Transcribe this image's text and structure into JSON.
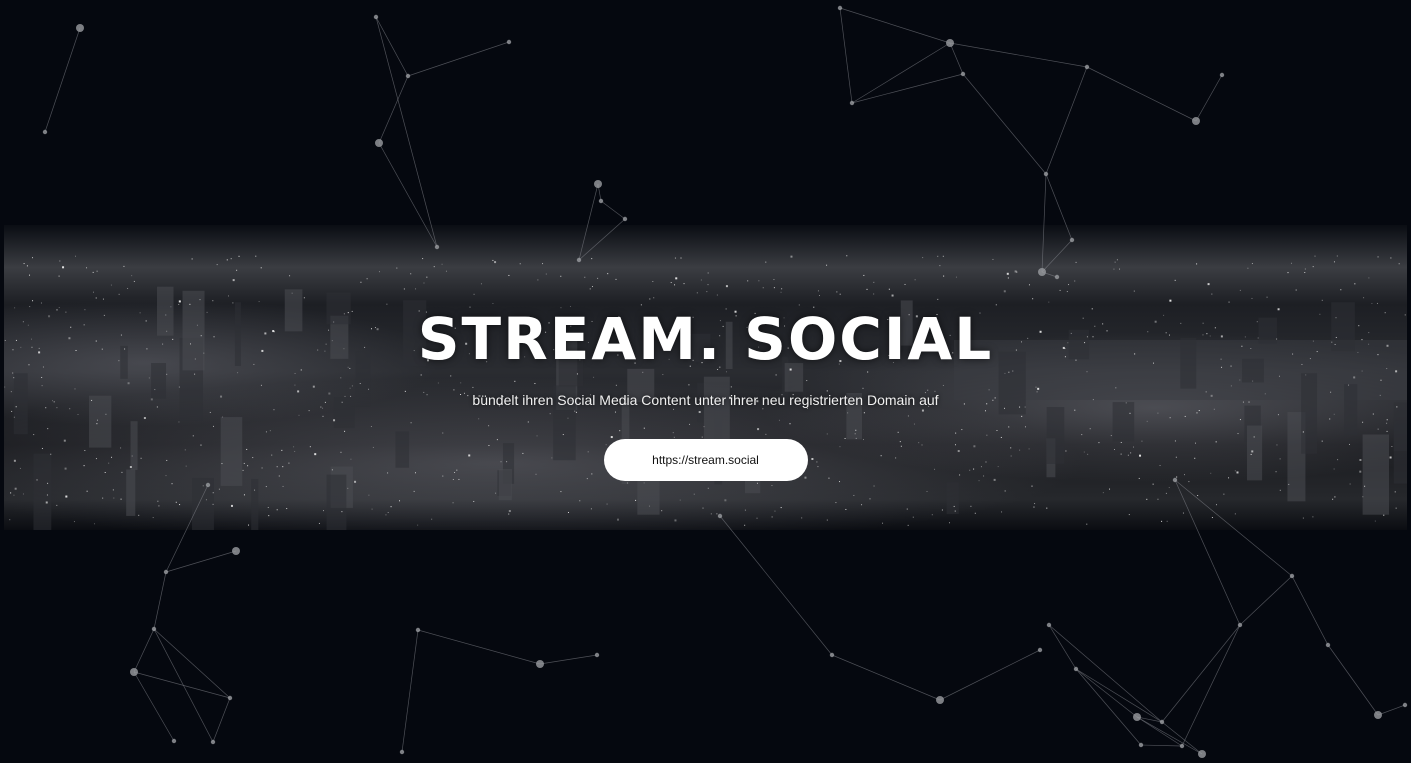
{
  "hero": {
    "title": "STREAM. SOCIAL",
    "subtitle": "bündelt ihren Social Media Content unter ihrer neu registrierten Domain auf",
    "button_label": "https://stream.social"
  },
  "colors": {
    "background": "#05080f",
    "text": "#ffffff",
    "button_background": "#ffffff",
    "button_text": "#111111",
    "network_line": "#8a8d93",
    "network_node": "#9a9ca0"
  }
}
